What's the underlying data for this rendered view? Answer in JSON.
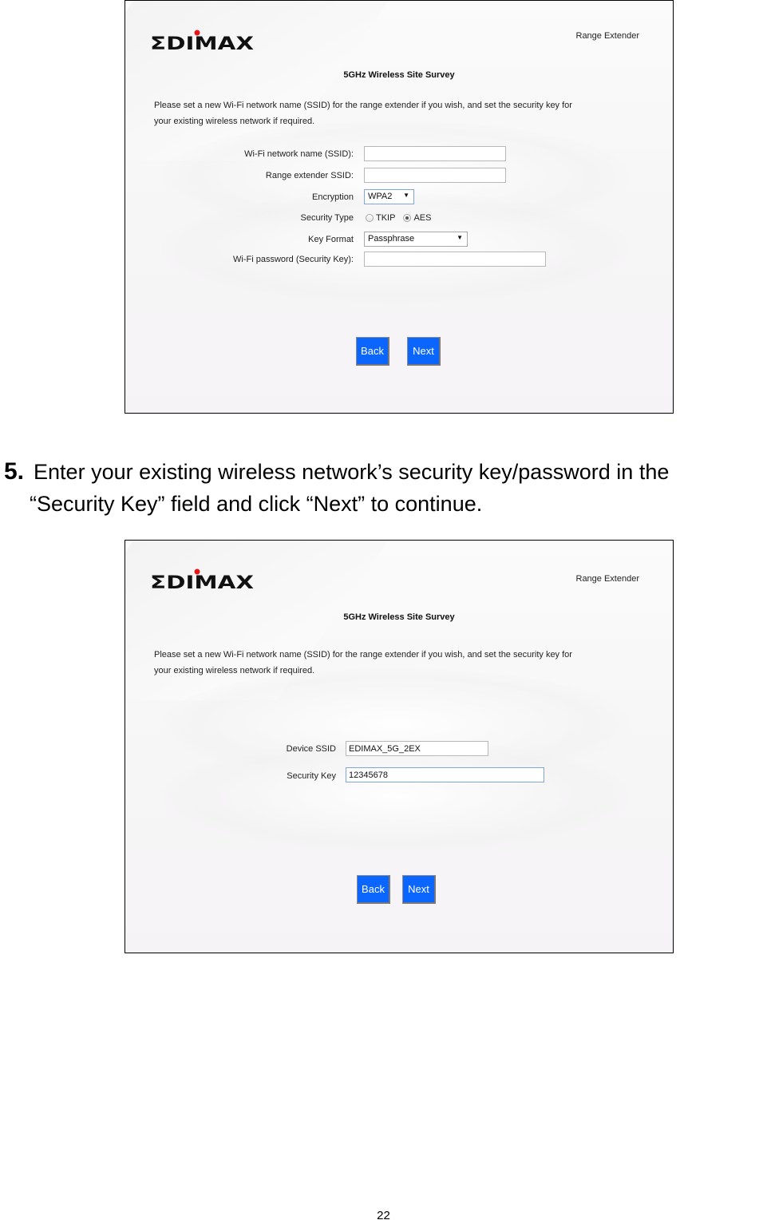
{
  "screenshot1": {
    "brand": "EDIMAX",
    "product": "Range Extender",
    "title": "5GHz  Wireless Site Survey",
    "instructions_line1": "Please set a new Wi-Fi network name (SSID) for the range extender if you wish, and set the security key for",
    "instructions_line2": "your existing wireless network if required.",
    "fields": {
      "ssid_label": "Wi-Fi network name (SSID):",
      "ssid_value": "",
      "extender_ssid_label": "Range extender SSID:",
      "extender_ssid_value": "",
      "encryption_label": "Encryption",
      "encryption_value": "WPA2",
      "security_type_label": "Security Type",
      "security_type_options": [
        "TKIP",
        "AES"
      ],
      "security_type_selected": "AES",
      "key_format_label": "Key Format",
      "key_format_value": "Passphrase",
      "password_label": "Wi-Fi password (Security Key):",
      "password_value": ""
    },
    "buttons": {
      "back": "Back",
      "next": "Next"
    }
  },
  "step": {
    "number": "5.",
    "line1": "Enter your existing wireless network’s security key/password in the",
    "line2": "“Security Key” field and click “Next” to continue."
  },
  "screenshot2": {
    "brand": "EDIMAX",
    "product": "Range Extender",
    "title": "5GHz Wireless Site Survey",
    "instructions_line1": "Please set a new Wi-Fi network name (SSID) for the range extender if you wish, and set the security key for",
    "instructions_line2": "your existing wireless network if required.",
    "fields": {
      "device_ssid_label": "Device SSID",
      "device_ssid_value": "EDIMAX_5G_2EX",
      "security_key_label": "Security Key",
      "security_key_value": "12345678"
    },
    "buttons": {
      "back": "Back",
      "next": "Next"
    }
  },
  "colors": {
    "button_blue": "#0a66ff",
    "logo_red": "#e8141b",
    "logo_black": "#111111"
  },
  "page_number": "22"
}
